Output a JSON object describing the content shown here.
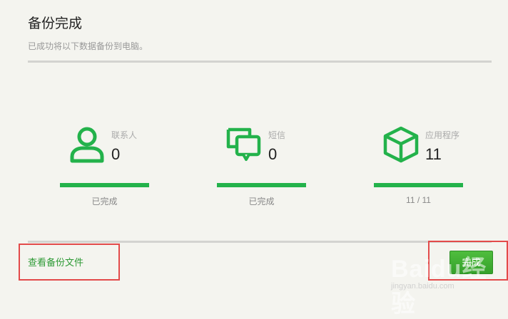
{
  "header": {
    "title": "备份完成",
    "subtitle": "已成功将以下数据备份到电脑。"
  },
  "items": [
    {
      "icon": "contact-icon",
      "label": "联系人",
      "count": "0",
      "status": "已完成",
      "progress": 1.0
    },
    {
      "icon": "message-icon",
      "label": "短信",
      "count": "0",
      "status": "已完成",
      "progress": 1.0
    },
    {
      "icon": "app-cube-icon",
      "label": "应用程序",
      "count": "11",
      "status": "11 / 11",
      "progress": 1.0
    }
  ],
  "footer": {
    "view_link": "查看备份文件",
    "done_button": "完成"
  },
  "watermark": {
    "text": "Baidu经验",
    "url": "jingyan.baidu.com"
  },
  "colors": {
    "accent": "#23b24b",
    "link": "#2e9a36",
    "highlight": "#e34a4a"
  }
}
